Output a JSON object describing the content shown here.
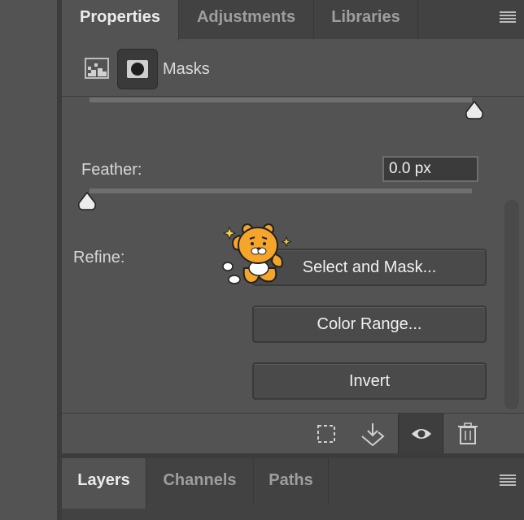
{
  "properties_panel": {
    "tabs": [
      {
        "label": "Properties",
        "active": true
      },
      {
        "label": "Adjustments",
        "active": false
      },
      {
        "label": "Libraries",
        "active": false
      }
    ],
    "menu_icon": "hamburger-menu-icon",
    "masks": {
      "label": "Masks",
      "pixel_mask_icon": "pixel-mask-icon",
      "vector_mask_icon": "vector-mask-icon"
    },
    "density_slider_value": 1.0,
    "feather": {
      "label": "Feather:",
      "value": "0.0 px",
      "slider_value": 0.0
    },
    "refine": {
      "label": "Refine:",
      "buttons": [
        "Select and Mask...",
        "Color Range...",
        "Invert"
      ]
    },
    "sticker": "cartoon-lion-sticker",
    "toolbar": [
      {
        "icon": "load-selection-icon"
      },
      {
        "icon": "apply-mask-icon"
      },
      {
        "icon": "eye-icon",
        "active": true
      },
      {
        "icon": "trash-icon"
      }
    ]
  },
  "layers_panel": {
    "tabs": [
      {
        "label": "Layers",
        "active": true
      },
      {
        "label": "Channels",
        "active": false
      },
      {
        "label": "Paths",
        "active": false
      }
    ],
    "menu_icon": "hamburger-menu-icon"
  },
  "colors": {
    "panel_bg": "#535353",
    "tab_bar_bg": "#424242",
    "divider": "#3c3c3c",
    "button_bg": "#4a4a4a",
    "input_bg": "#3b3b3b"
  }
}
